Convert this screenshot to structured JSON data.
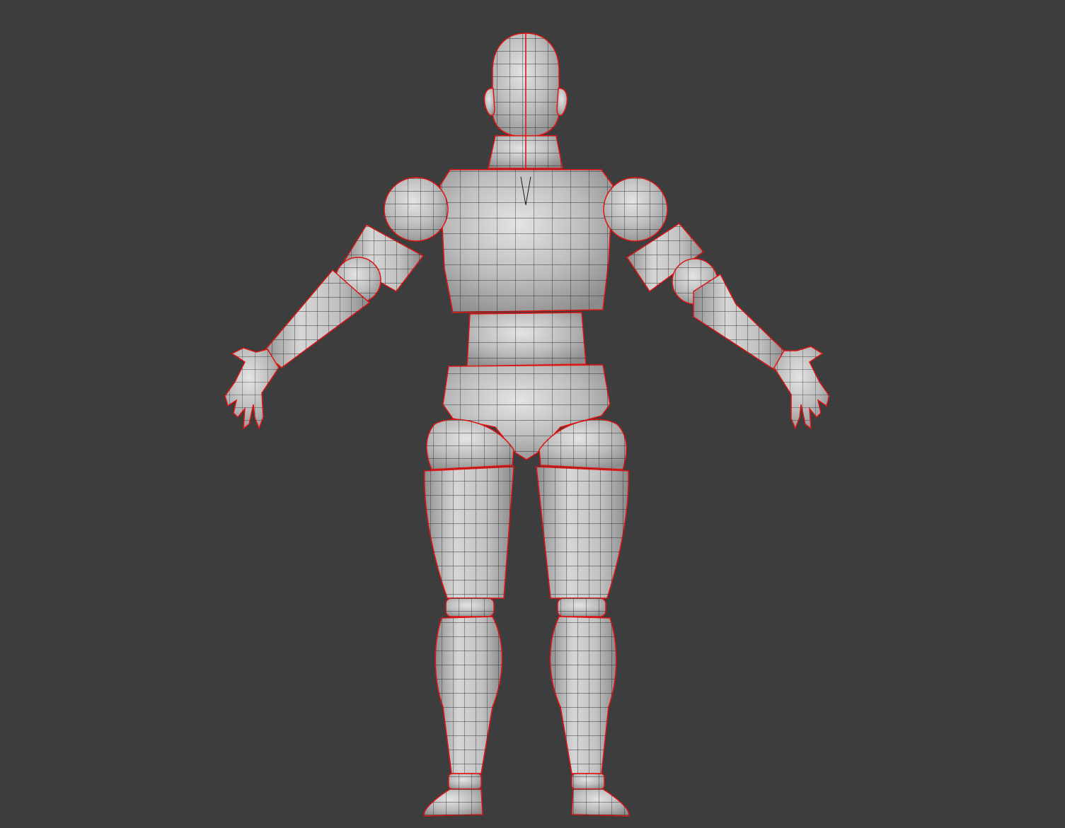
{
  "viewport": {
    "background": "#3d3d3d",
    "mode": "edit",
    "shading": "solid",
    "overlay": "wireframe"
  },
  "mesh": {
    "subject": "humanoid-figure-back-view",
    "surface_color": "#bdbdbd",
    "surface_highlight": "#e2e2e2",
    "surface_shadow": "#8a8a8a",
    "wire_color": "#1c1c1c",
    "seam_color": "#e11414",
    "parts": [
      "head",
      "ear-left",
      "ear-right",
      "neck",
      "torso",
      "shoulder-left",
      "shoulder-right",
      "upper-arm-left",
      "upper-arm-right",
      "elbow-left",
      "elbow-right",
      "forearm-left",
      "forearm-right",
      "hand-left",
      "hand-right",
      "waist",
      "hips",
      "glute-left",
      "glute-right",
      "thigh-left",
      "thigh-right",
      "knee-left",
      "knee-right",
      "shin-left",
      "shin-right",
      "ankle-left",
      "ankle-right",
      "foot-left",
      "foot-right"
    ]
  }
}
